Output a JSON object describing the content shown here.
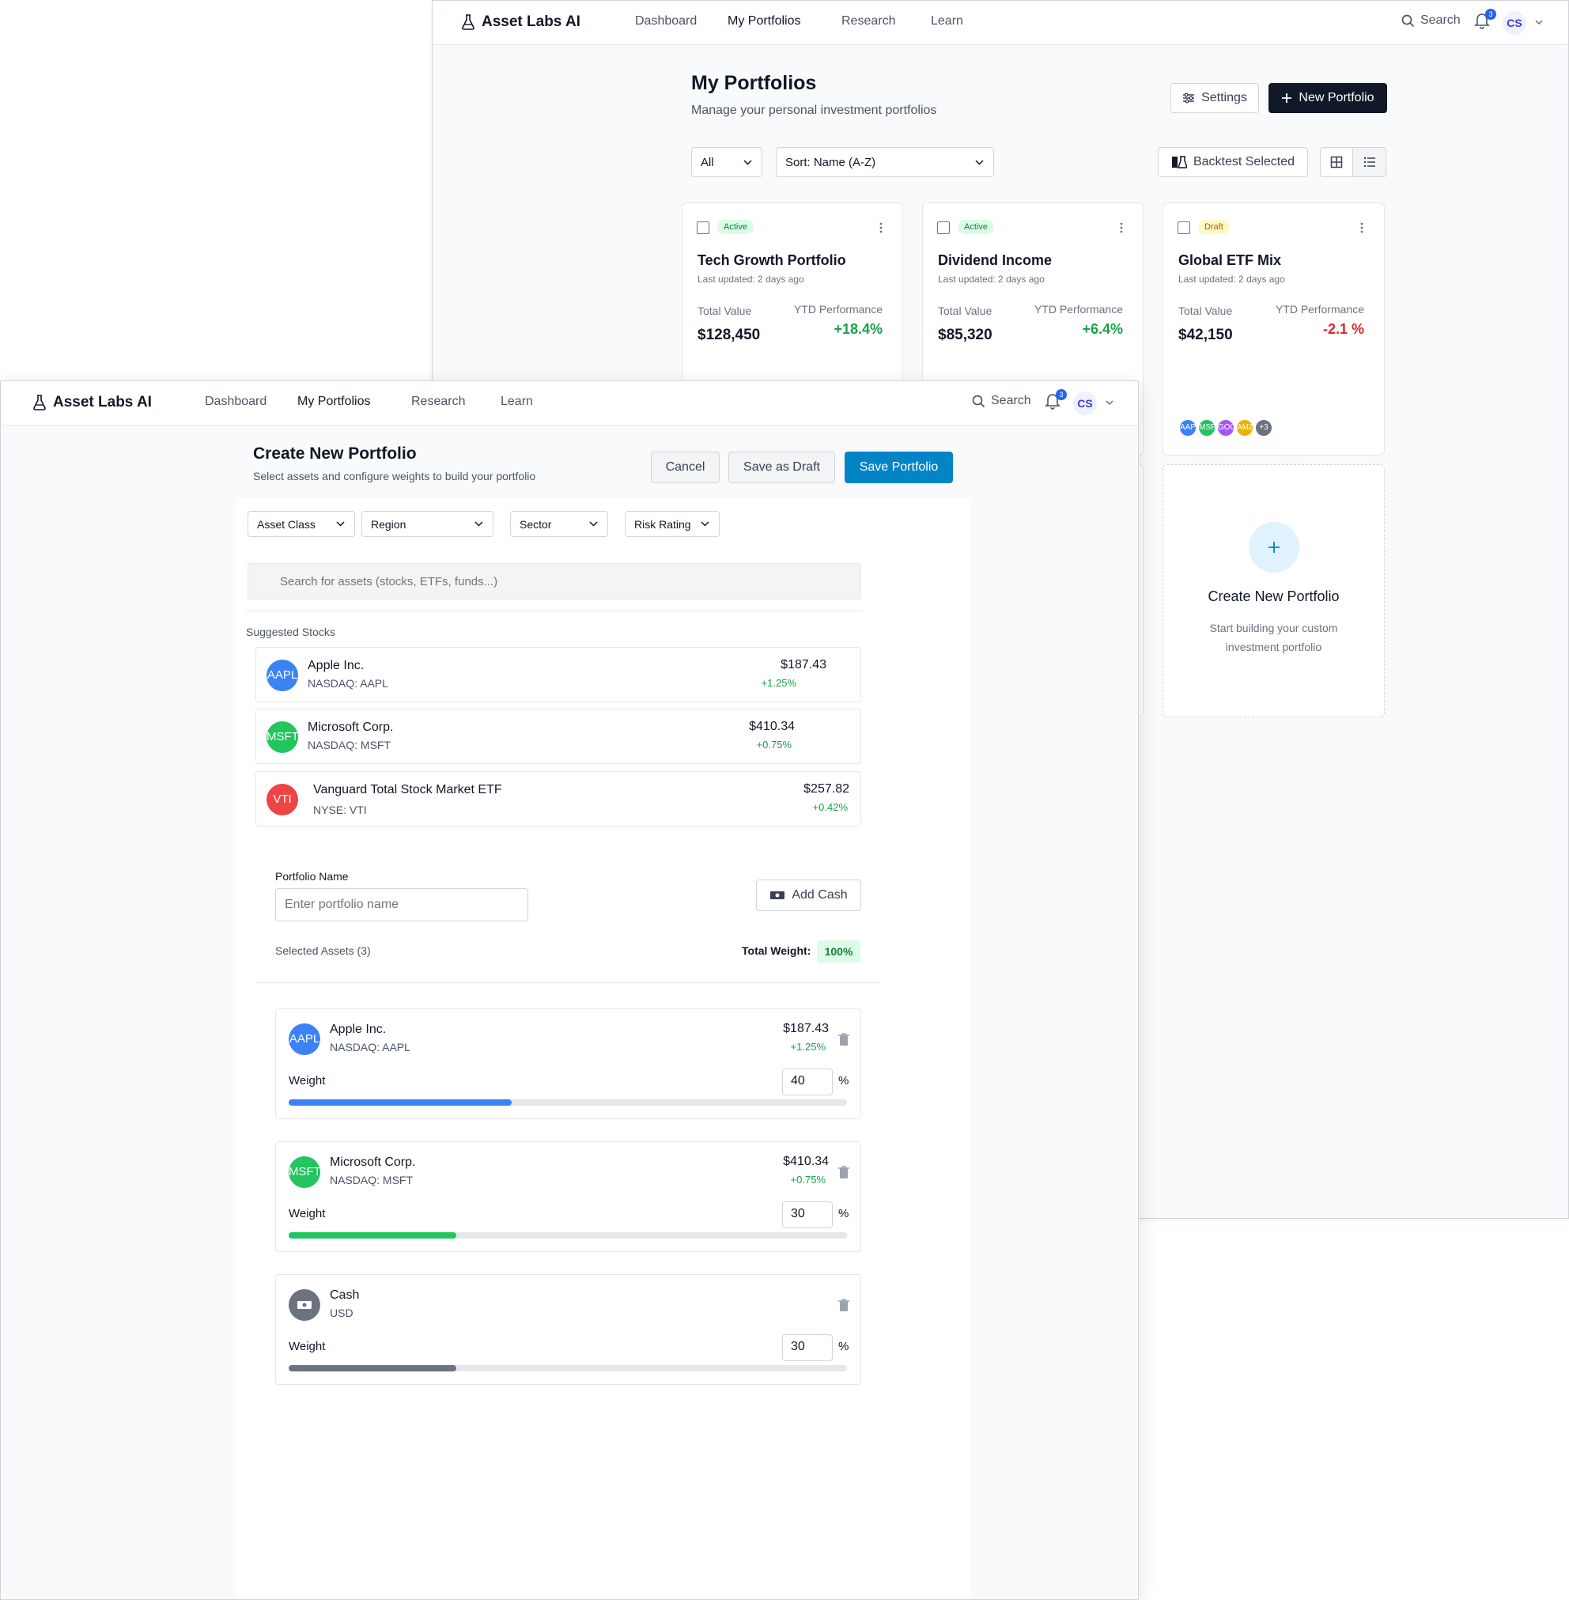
{
  "back": {
    "nav": {
      "brand": "Asset Labs AI",
      "links": [
        "Dashboard",
        "My Portfolios",
        "Research",
        "Learn"
      ],
      "search": "Search",
      "notifications": "3",
      "avatar": "CS"
    },
    "title": "My Portfolios",
    "subtitle": "Manage your personal investment portfolios",
    "settings": "Settings",
    "new_portfolio": "New Portfolio",
    "filter": "All",
    "sort": "Sort: Name (A-Z)",
    "backtest": "Backtest Selected",
    "labels": {
      "total_value": "Total Value",
      "ytd": "YTD Performance"
    },
    "cards": [
      {
        "status": "Active",
        "name": "Tech Growth Portfolio",
        "updated": "Last updated: 2 days ago",
        "value": "$128,450",
        "perf": "+18.4%",
        "perf_color": "#16a34a"
      },
      {
        "status": "Active",
        "name": "Dividend Income",
        "updated": "Last updated: 2 days ago",
        "value": "$85,320",
        "perf": "+6.4%",
        "perf_color": "#16a34a"
      },
      {
        "status": "Draft",
        "name": "Global ETF Mix",
        "updated": "Last updated: 2 days ago",
        "value": "$42,150",
        "perf": "-2.1 %",
        "perf_color": "#dc2626"
      }
    ],
    "chips": [
      {
        "label": "AAPL",
        "color": "#3b82f6"
      },
      {
        "label": "MSFT",
        "color": "#22c55e"
      },
      {
        "label": "GOOG",
        "color": "#a855f7"
      },
      {
        "label": "AMZN",
        "color": "#eab308"
      },
      {
        "label": "+3",
        "color": "#6b7280"
      }
    ],
    "create": {
      "title": "Create New Portfolio",
      "desc_line1": "Start building your custom",
      "desc_line2": "investment portfolio"
    }
  },
  "front": {
    "nav": {
      "brand": "Asset Labs AI",
      "links": [
        "Dashboard",
        "My Portfolios",
        "Research",
        "Learn"
      ],
      "search": "Search",
      "notifications": "3",
      "avatar": "CS"
    },
    "title": "Create New Portfolio",
    "subtitle": "Select assets and configure weights to build your portfolio",
    "cancel": "Cancel",
    "save_draft": "Save as Draft",
    "save": "Save Portfolio",
    "filters": [
      "Asset Class",
      "Region",
      "Sector",
      "Risk Rating"
    ],
    "search_placeholder": "Search for assets (stocks, ETFs, funds...)",
    "suggested_label": "Suggested Stocks",
    "suggested": [
      {
        "logo": "AAPL",
        "color": "#3b82f6",
        "name": "Apple Inc.",
        "exchange": "NASDAQ: AAPL",
        "price": "$187.43",
        "change": "+1.25%"
      },
      {
        "logo": "MSFT",
        "color": "#22c55e",
        "name": "Microsoft Corp.",
        "exchange": "NASDAQ: MSFT",
        "price": "$410.34",
        "change": "+0.75%"
      },
      {
        "logo": "VTI",
        "color": "#ef4444",
        "name": "Vanguard Total Stock Market ETF",
        "exchange": "NYSE: VTI",
        "price": "$257.82",
        "change": "+0.42%"
      }
    ],
    "portfolio_name_label": "Portfolio Name",
    "portfolio_name_placeholder": "Enter portfolio name",
    "add_cash": "Add Cash",
    "selected_label": "Selected Assets (3)",
    "total_weight_label": "Total Weight:",
    "total_weight": "100%",
    "weight_label": "Weight",
    "percent_sign": "%",
    "selected": [
      {
        "logo": "AAPL",
        "color": "#3b82f6",
        "name": "Apple Inc.",
        "exchange": "NASDAQ: AAPL",
        "price": "$187.43",
        "change": "+1.25%",
        "weight": "40",
        "weight_fraction": 0.4
      },
      {
        "logo": "MSFT",
        "color": "#22c55e",
        "name": "Microsoft Corp.",
        "exchange": "NASDAQ: MSFT",
        "price": "$410.34",
        "change": "+0.75%",
        "weight": "30",
        "weight_fraction": 0.3
      },
      {
        "logo": "cash-icon",
        "color": "#6b7280",
        "name": "Cash",
        "exchange": "USD",
        "price": "",
        "change": "",
        "weight": "30",
        "weight_fraction": 0.3
      }
    ]
  }
}
